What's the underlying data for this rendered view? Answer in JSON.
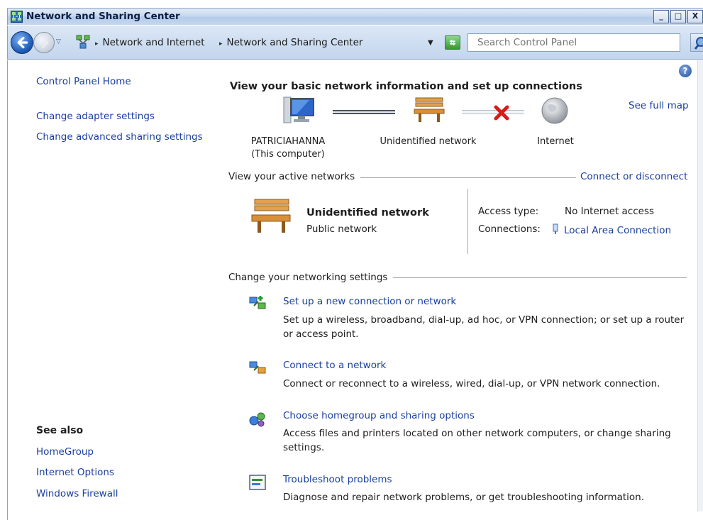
{
  "window": {
    "title": "Network and Sharing Center",
    "controls": [
      "_",
      "□",
      "X"
    ]
  },
  "address_bar": {
    "crumbs": [
      "Network and Internet",
      "Network and Sharing Center"
    ],
    "search_placeholder": "Search Control Panel"
  },
  "sidebar": {
    "home": "Control Panel Home",
    "links": [
      "Change adapter settings",
      "Change advanced sharing settings"
    ],
    "see_also_heading": "See also",
    "see_also": [
      "HomeGroup",
      "Internet Options",
      "Windows Firewall"
    ]
  },
  "main": {
    "heading": "View your basic network information and set up connections",
    "see_full_map": "See full map",
    "map": {
      "computer_name": "PATRICIAHANNA",
      "computer_sub": "(This computer)",
      "network": "Unidentified network",
      "internet": "Internet"
    },
    "active_networks": {
      "label": "View your active networks",
      "connect_link": "Connect or disconnect",
      "network_name": "Unidentified network",
      "network_type": "Public network",
      "access_type_label": "Access type:",
      "access_type_value": "No Internet access",
      "connections_label": "Connections:",
      "connections_value": "Local Area Connection"
    },
    "networking_settings": {
      "label": "Change your networking settings",
      "tasks": [
        {
          "title": "Set up a new connection or network",
          "desc": "Set up a wireless, broadband, dial-up, ad hoc, or VPN connection; or set up a router or access point."
        },
        {
          "title": "Connect to a network",
          "desc": "Connect or reconnect to a wireless, wired, dial-up, or VPN network connection."
        },
        {
          "title": "Choose homegroup and sharing options",
          "desc": "Access files and printers located on other network computers, or change sharing settings."
        },
        {
          "title": "Troubleshoot problems",
          "desc": "Diagnose and repair network problems, or get troubleshooting information."
        }
      ]
    }
  }
}
